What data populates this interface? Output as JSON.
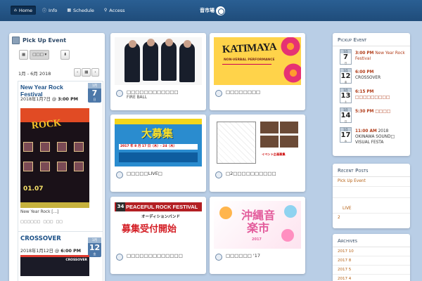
{
  "nav": {
    "items": [
      {
        "label": "Home",
        "icon": "home-icon",
        "glyph": "⌂"
      },
      {
        "label": "Info",
        "icon": "info-icon",
        "glyph": "ⓘ"
      },
      {
        "label": "Schedule",
        "icon": "calendar-icon",
        "glyph": "▦"
      },
      {
        "label": "Access",
        "icon": "map-marker-icon",
        "glyph": "⚲"
      }
    ],
    "logo": "音市場"
  },
  "pickup_panel": {
    "title": "Pick Up Event",
    "toolbar": [
      "▦",
      "□□□ ▾",
      "⬇"
    ],
    "range": "1月 - 6月 2018",
    "events": [
      {
        "title": "New Year Rock Festival",
        "month": "1月",
        "day": "7",
        "weekday": "日",
        "time_prefix": "2018年1月7日 @",
        "time": "3:00 PM",
        "description": "New Year Rock [...]",
        "tags": [
          "□□□□□□",
          "□□□",
          "□□"
        ],
        "poster_title": "ROCK",
        "poster_date": "01.07"
      },
      {
        "title": "CROSSOVER",
        "month": "1月",
        "day": "12",
        "weekday": "金",
        "time_prefix": "2018年1月12日 @",
        "time": "6:00 PM",
        "poster_label": "CROSSOVER"
      }
    ]
  },
  "tiles": [
    {
      "caption": "□□□□□□□□□□□□",
      "subtitle": "FIRE BALL"
    },
    {
      "caption": "□□□□□□□□",
      "subtitle": "",
      "image_text": "KATIMAYA",
      "image_sub": "NON-VERBAL PERFORMANCE"
    },
    {
      "caption": "□□□□□LIVE□",
      "subtitle": "",
      "image_text": "大募集",
      "image_row": "2017 年 8 月 17 日（木）- 24（木）"
    },
    {
      "caption": "□2□□□□□□□□□□",
      "subtitle": "",
      "image_label": "イベント企画募集"
    },
    {
      "caption": "□□□□□□□□□□□□□",
      "subtitle": "",
      "image_num": "34",
      "image_header": "PEACEFUL ROCK FESTIVAL 2017",
      "image_audition": "オーディションバンド",
      "image_big": "募集受付開始"
    },
    {
      "caption": "□□□□□□ '17",
      "subtitle": "",
      "image_text": "沖縄音楽市",
      "image_sub": "2017"
    }
  ],
  "pickup_sidebar": {
    "title": "Pickup Event",
    "items": [
      {
        "month": "1月",
        "day": "7",
        "weekday": "日",
        "time": "3:00 PM",
        "text": "New Year Rock Festival"
      },
      {
        "month": "1月",
        "day": "12",
        "weekday": "金",
        "time": "6:00 PM",
        "text": "CROSSOVER"
      },
      {
        "month": "1月",
        "day": "13",
        "weekday": "土",
        "time": "6:15 PM",
        "text": "□□□□□□□□□"
      },
      {
        "month": "1月",
        "day": "14",
        "weekday": "日",
        "time": "5:30 PM",
        "text": "□□□□"
      },
      {
        "month": "1月",
        "day": "17",
        "weekday": "水",
        "time": "11:00 AM",
        "text": "2018 OKINAWA SOUND□ VISUAL FESTA"
      }
    ]
  },
  "recent_posts": {
    "title": "Recent Posts",
    "items": [
      "Pick Up Event",
      "",
      "",
      "LIVE",
      "2"
    ]
  },
  "archives": {
    "title": "Archives",
    "items": [
      "2017 10",
      "2017 8",
      "2017 5",
      "2017 4"
    ]
  },
  "colors": {
    "nav_bg": "#1f4c7a",
    "page_bg": "#b9cee6",
    "title_blue": "#1a4f86",
    "link_orange": "#b45e10"
  }
}
